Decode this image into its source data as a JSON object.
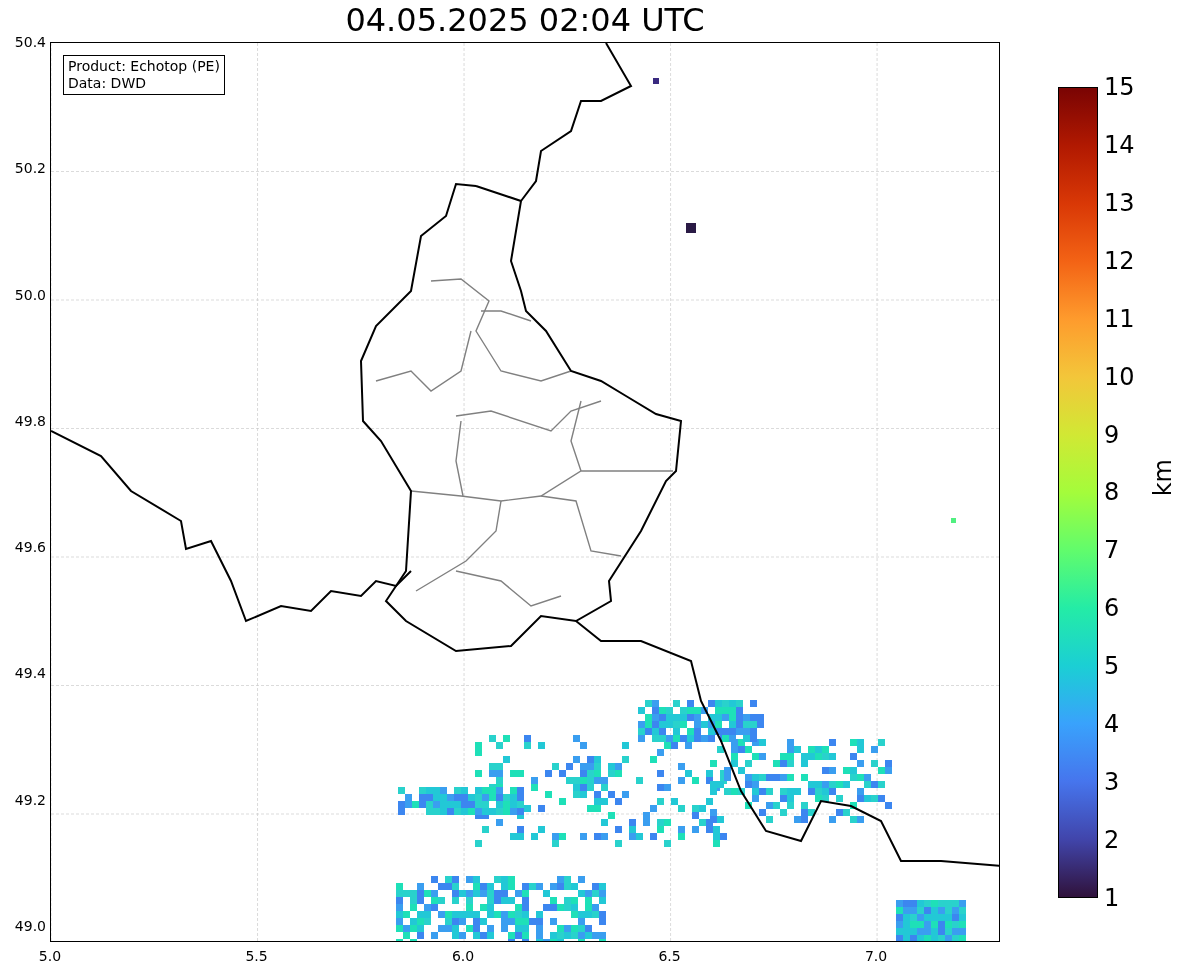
{
  "title": "04.05.2025 02:04 UTC",
  "info": [
    "Product: Echotop (PE)",
    "Data: DWD"
  ],
  "y_ticks": [
    "50.4",
    "50.2",
    "50.0",
    "49.8",
    "49.6",
    "49.4",
    "49.2",
    "49.0"
  ],
  "x_ticks": [
    "5.0",
    "5.5",
    "6.0",
    "6.5",
    "7.0"
  ],
  "colorbar": {
    "label": "km",
    "ticks": [
      "15",
      "14",
      "13",
      "12",
      "11",
      "10",
      "9",
      "8",
      "7",
      "6",
      "5",
      "4",
      "3",
      "2",
      "1"
    ]
  }
}
